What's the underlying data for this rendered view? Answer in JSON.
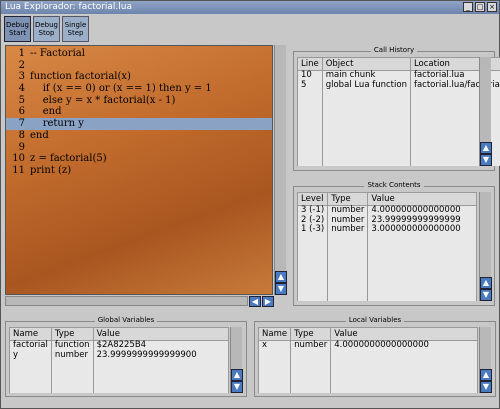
{
  "window": {
    "title": "Lua Explorador: factorial.lua"
  },
  "titlebar_buttons": [
    "_",
    "□",
    "×"
  ],
  "toolbar": [
    {
      "label": "Debug Start",
      "active": true
    },
    {
      "label": "Debug Stop",
      "active": false
    },
    {
      "label": "Single Step",
      "active": false
    }
  ],
  "code": {
    "highlighted_line": 7,
    "lines": [
      {
        "n": "1",
        "text": "-- Factorial"
      },
      {
        "n": "2",
        "text": ""
      },
      {
        "n": "3",
        "text": "function factorial(x)"
      },
      {
        "n": "4",
        "text": "    if (x == 0) or (x == 1) then y = 1"
      },
      {
        "n": "5",
        "text": "    else y = x * factorial(x - 1)"
      },
      {
        "n": "6",
        "text": "    end"
      },
      {
        "n": "7",
        "text": "    return y"
      },
      {
        "n": "8",
        "text": "end"
      },
      {
        "n": "9",
        "text": ""
      },
      {
        "n": "10",
        "text": "z = factorial(5)"
      },
      {
        "n": "11",
        "text": "print (z)"
      }
    ]
  },
  "call_history": {
    "title": "Call History",
    "columns": [
      "Line",
      "Object",
      "Location"
    ],
    "rows": [
      [
        "10",
        "main chunk",
        "factorial.lua"
      ],
      [
        "5",
        "global Lua function",
        "factorial.lua/factorial()"
      ]
    ]
  },
  "stack": {
    "title": "Stack Contents",
    "columns": [
      "Level",
      "Type",
      "Value"
    ],
    "rows": [
      [
        "3 (-1)",
        "number",
        "4.000000000000000"
      ],
      [
        "2 (-2)",
        "number",
        "23.99999999999999"
      ],
      [
        "1 (-3)",
        "number",
        "3.000000000000000"
      ]
    ]
  },
  "globals": {
    "title": "Global Variables",
    "columns": [
      "Name",
      "Type",
      "Value"
    ],
    "rows": [
      [
        "factorial",
        "function",
        "$2A8225B4"
      ],
      [
        "y",
        "number",
        "23.9999999999999900"
      ]
    ]
  },
  "locals": {
    "title": "Local Variables",
    "columns": [
      "Name",
      "Type",
      "Value"
    ],
    "rows": [
      [
        "x",
        "number",
        "4.0000000000000000"
      ]
    ]
  },
  "scroll_arrows": {
    "up": "▲",
    "down": "▼",
    "left": "◀",
    "right": "▶"
  }
}
